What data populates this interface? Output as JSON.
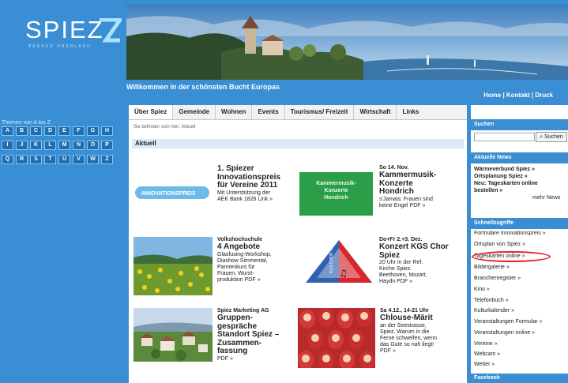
{
  "header": {
    "logo_text": "SPIEZ",
    "logo_tagline": "BERNER OBERLAND",
    "welcome": "Willkommen in der schönsten Bucht Europas",
    "top_links": "Home | Kontakt | Druck"
  },
  "alphabet": {
    "title": "Themen von A bis Z",
    "letters": [
      "A",
      "B",
      "C",
      "D",
      "E",
      "F",
      "G",
      "H",
      "I",
      "J",
      "K",
      "L",
      "M",
      "N",
      "O",
      "P",
      "Q",
      "R",
      "S",
      "T",
      "U",
      "V",
      "W",
      "Z"
    ]
  },
  "nav": {
    "tabs": [
      "Über Spiez",
      "Gemeinde",
      "Wohnen",
      "Events",
      "Tourismus/ Freizeit",
      "Wirtschaft",
      "Links"
    ]
  },
  "content": {
    "breadcrumb": "Sie befinden sich hier: Aktuell",
    "section_title": "Aktuell",
    "news": [
      {
        "lines": [
          "1. Spiezer",
          "Innovationspreis",
          "für Vereine 2011"
        ],
        "desc": [
          "Mit Unterstützung der",
          "AEK Bank 1826 Link »"
        ]
      },
      {
        "lines": [
          "So 14. Nov.",
          "Kammermusik-",
          "Konzerte",
          "Hondrich"
        ],
        "desc": [
          "s'Jamais: Frauen sind",
          "keine Engel PDF »"
        ]
      },
      {
        "small": "Volkshochschule",
        "lines": [
          "4 Angebote"
        ],
        "desc": [
          "Glasfusing-Workshop,",
          "Diashow Simmental,",
          "Pannenkurs für",
          "Frauen, Wurst-",
          "produktion PDF »"
        ]
      },
      {
        "small": "Do+Fr 2.+3. Dez.",
        "lines": [
          "Konzert KGS Chor",
          "Spiez"
        ],
        "desc": [
          "20 Uhr in der Ref.",
          "Kirche Spiez.",
          "Beethoven, Mozart,",
          "Haydn PDF »"
        ]
      },
      {
        "small": "Spiez Marketing AG",
        "lines": [
          "Gruppen-",
          "gespräche",
          "Standort Spiez –",
          "Zusammen-",
          "fassung"
        ],
        "desc": [
          "PDF »"
        ]
      },
      {
        "small": "Sa 4.12., 14-21 Uhr",
        "lines": [
          "Chlouse-Märit"
        ],
        "desc": [
          "an der Seestrasse,",
          "Spiez. Warum in die",
          "Ferne schweifen, wenn",
          "das Gute so nah liegt!",
          "PDF »"
        ]
      }
    ],
    "innov_logo_text": "INNOVATIONSPREIS",
    "kammer_box": [
      "Kammermusik-",
      "Konzerte",
      "Hondrich"
    ],
    "triangle_text": "KGS CHOR SPIEZ"
  },
  "sidebar": {
    "suchen_title": "Suchen",
    "search_value": "",
    "search_button": "Suchen",
    "news_title": "Aktuelle News",
    "news_items": [
      "Wärmeverbund Spiez »",
      "Ortsplanung Spiez »",
      "Neu: Tageskarten online",
      "bestellen »"
    ],
    "more_news": "mehr News",
    "shortcuts_title": "Schnellzugriffe",
    "shortcuts": [
      "Formulare Innovationspreis »",
      "Ortsplan von Spiez »",
      "Tageskarten online »",
      "Bildergalerie »",
      "Branchenregister »",
      "Kino »",
      "Telefonbuch »",
      "Kulturkalender »",
      "Veranstaltungen Formular »",
      "Veranstaltungen online »",
      "Vereine »",
      "Webcam »",
      "Wetter »"
    ],
    "facebook_title": "Facebook"
  },
  "colors": {
    "brand_blue": "#3a8ed3",
    "highlight_circle": "#e32020",
    "kammer_green": "#2c9e48"
  }
}
